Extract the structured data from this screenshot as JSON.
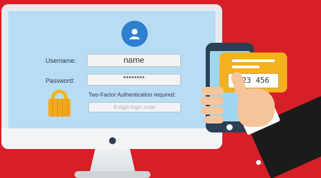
{
  "login_form": {
    "username_label": "Username:",
    "username_value": "name",
    "password_label": "Password:",
    "password_value": "********",
    "two_factor_label": "Two-Factor Authentication required:",
    "code_placeholder": "6-digit login code"
  },
  "phone_notification": {
    "code": "123 456"
  },
  "colors": {
    "background": "#d61f26",
    "screen": "#b7dcf3",
    "accent": "#2f7fcf",
    "padlock": "#f2a81c",
    "bubble": "#f5b11e"
  },
  "icons": [
    "user-icon",
    "padlock-icon",
    "smartphone-icon",
    "message-bubble-icon",
    "hand-icon"
  ]
}
